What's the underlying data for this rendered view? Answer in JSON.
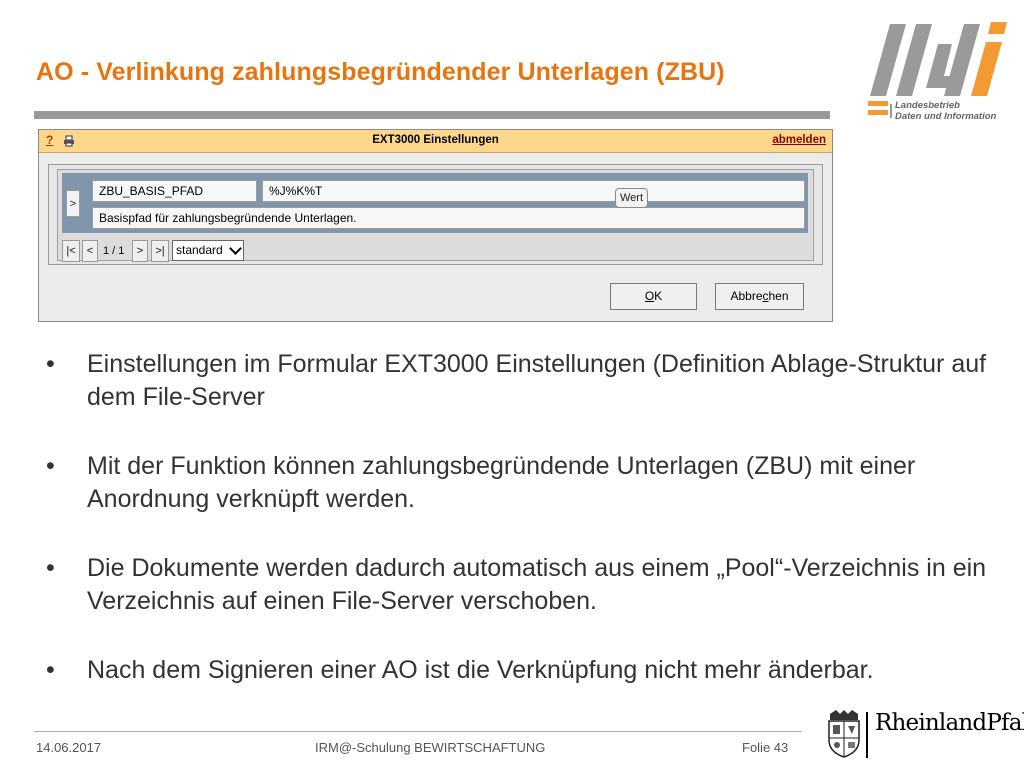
{
  "slide": {
    "title": "AO - Verlinkung zahlungsbegründender Unterlagen (ZBU)"
  },
  "logo": {
    "name": "ldi",
    "subtitle_line1": "Landesbetrieb",
    "subtitle_line2": "Daten und Information",
    "colors": {
      "grey": "#9a9a9a",
      "orange": "#F39A33"
    }
  },
  "app": {
    "help_label": "?",
    "print_icon": "printer-icon",
    "title": "EXT3000 Einstellungen",
    "logout_label": "abmelden",
    "titlebar_color": "#fcd78c",
    "row_color": "#7f96ad",
    "record": {
      "expand_label": ">",
      "key": "ZBU_BASIS_PFAD",
      "value": "%J%K%T",
      "tooltip": "Wert",
      "description": "Basispfad für zahlungsbegründende Unterlagen."
    },
    "navigation": {
      "first": "|<",
      "prev": "<",
      "counter": "1 / 1",
      "next": ">",
      "last": ">|",
      "view_selected": "standard"
    },
    "buttons": {
      "ok_pre": "",
      "ok_mnemonic": "O",
      "ok_post": "K",
      "cancel_pre": "Abbre",
      "cancel_mnemonic": "c",
      "cancel_post": "hen"
    }
  },
  "bullets": [
    "Einstellungen im Formular EXT3000 Einstellungen (Definition Ablage-Struktur auf dem File-Server",
    "Mit der Funktion können zahlungsbegründende Unterlagen (ZBU) mit einer Anordnung verknüpft werden.",
    "Die Dokumente werden dadurch automatisch aus einem „Pool“-Verzeichnis in ein Verzeichnis auf einen File-Server verschoben.",
    "Nach dem Signieren einer AO ist die Verknüpfung nicht mehr änderbar."
  ],
  "bullet_symbol": "•",
  "footer": {
    "date": "14.06.2017",
    "center": "IRM@-Schulung BEWIRTSCHAFTUNG",
    "slide_number": "Folie 43",
    "state_logo": "RheinlandPfalz"
  }
}
